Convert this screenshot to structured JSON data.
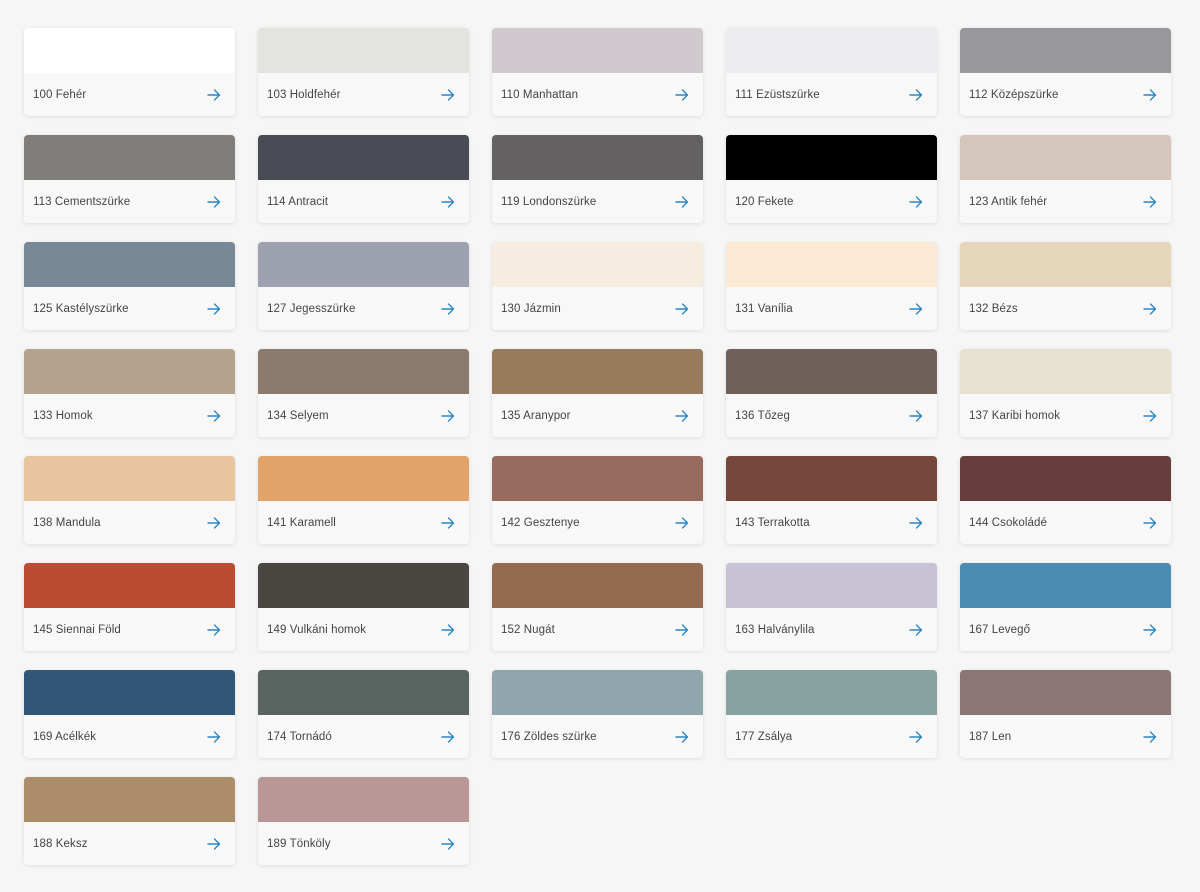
{
  "arrow_color": "#2e86c1",
  "arrow_icon": "arrow-right-icon",
  "colors": [
    {
      "label": "100 Fehér",
      "hex": "#ffffff"
    },
    {
      "label": "103 Holdfehér",
      "hex": "#e3e4e0"
    },
    {
      "label": "110 Manhattan",
      "hex": "#d0cace"
    },
    {
      "label": "111 Ezüstszürke",
      "hex": "#ececee"
    },
    {
      "label": "112 Középszürke",
      "hex": "#98979c"
    },
    {
      "label": "113 Cementszürke",
      "hex": "#807e7a"
    },
    {
      "label": "114 Antracit",
      "hex": "#494c55"
    },
    {
      "label": "119 Londonszürke",
      "hex": "#636162"
    },
    {
      "label": "120 Fekete",
      "hex": "#010101"
    },
    {
      "label": "123 Antik fehér",
      "hex": "#d4c5bd"
    },
    {
      "label": "125 Kastélyszürke",
      "hex": "#788897"
    },
    {
      "label": "127 Jegesszürke",
      "hex": "#9ea2b0"
    },
    {
      "label": "130 Jázmin",
      "hex": "#f6ecdf"
    },
    {
      "label": "131 Vanília",
      "hex": "#fbe9d4"
    },
    {
      "label": "132 Bézs",
      "hex": "#e5d5ba"
    },
    {
      "label": "133 Homok",
      "hex": "#b4a28f"
    },
    {
      "label": "134 Selyem",
      "hex": "#8b7b6c"
    },
    {
      "label": "135 Aranypor",
      "hex": "#987a5c"
    },
    {
      "label": "136 Tőzeg",
      "hex": "#6f6059"
    },
    {
      "label": "137 Karibi homok",
      "hex": "#e7e2d0"
    },
    {
      "label": "138 Mandula",
      "hex": "#e7c59f"
    },
    {
      "label": "141 Karamell",
      "hex": "#e2a368"
    },
    {
      "label": "142 Gesztenye",
      "hex": "#976b5e"
    },
    {
      "label": "143 Terrakotta",
      "hex": "#77473b"
    },
    {
      "label": "144 Csokoládé",
      "hex": "#673e3e"
    },
    {
      "label": "145 Siennai Föld",
      "hex": "#bb4c33"
    },
    {
      "label": "149 Vulkáni homok",
      "hex": "#4a4642"
    },
    {
      "label": "152 Nugát",
      "hex": "#946a51"
    },
    {
      "label": "163 Halványlila",
      "hex": "#c7c3d5"
    },
    {
      "label": "167 Levegő",
      "hex": "#4c8cb3"
    },
    {
      "label": "169 Acélkék",
      "hex": "#325776"
    },
    {
      "label": "174 Tornádó",
      "hex": "#596461"
    },
    {
      "label": "176 Zöldes szürke",
      "hex": "#8fa6ad"
    },
    {
      "label": "177 Zsálya",
      "hex": "#86a39f"
    },
    {
      "label": "187 Len",
      "hex": "#8b7675"
    },
    {
      "label": "188 Keksz",
      "hex": "#ab8e69"
    },
    {
      "label": "189 Tönköly",
      "hex": "#b99797"
    }
  ]
}
